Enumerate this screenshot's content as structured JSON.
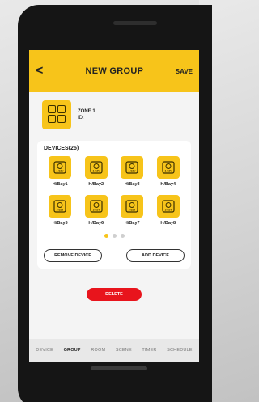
{
  "header": {
    "back_glyph": "<",
    "title": "NEW GROUP",
    "save_label": "SAVE"
  },
  "zone": {
    "name": "ZONE 1",
    "id_label": "ID:",
    "thumb_icon": "switch-grid-icon"
  },
  "devices": {
    "title": "DEVICES(25)",
    "icon": "switch-icon",
    "icon_label": "1-S2V",
    "items": [
      {
        "label": "H/Bay1"
      },
      {
        "label": "H/Bay2"
      },
      {
        "label": "H/Bay3"
      },
      {
        "label": "H/Bay4"
      },
      {
        "label": "H/Bay5"
      },
      {
        "label": "H/Bay6"
      },
      {
        "label": "H/Bay7"
      },
      {
        "label": "H/Bay8"
      }
    ],
    "pages": 3,
    "active_page": 1
  },
  "actions": {
    "remove_label": "REMOVE DEVICE",
    "add_label": "ADD DEVICE",
    "delete_label": "DELETE"
  },
  "tabs": [
    {
      "label": "DEVICE",
      "active": false
    },
    {
      "label": "GROUP",
      "active": true
    },
    {
      "label": "ROOM",
      "active": false
    },
    {
      "label": "SCENE",
      "active": false
    },
    {
      "label": "TIMER",
      "active": false
    },
    {
      "label": "SCHEDULE",
      "active": false
    }
  ],
  "colors": {
    "accent": "#f7c41a",
    "danger": "#e8141c"
  }
}
